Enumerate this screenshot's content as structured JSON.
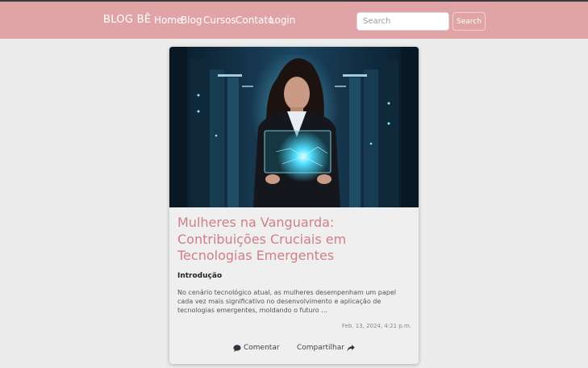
{
  "navbar": {
    "brand": "BLOG BÊ",
    "links": [
      "Home",
      "Blog",
      "Cursos",
      "Contato",
      "Login"
    ],
    "search_placeholder": "Search",
    "search_button": "Search"
  },
  "post": {
    "image_icon": "woman-holding-holographic-tablet-in-server-room",
    "title": "Mulheres na Vanguarda: Contribuições Cruciais em Tecnologias Emergentes",
    "section_heading": "Introdução",
    "excerpt": "No cenário tecnológico atual, as mulheres desempenham um papel cada vez mais significativo no desenvolvimento e aplicação de tecnologias emergentes, moldando o futuro ...",
    "date": "Feb. 13, 2024, 4:21 p.m.",
    "comment_label": "Comentar",
    "comment_icon": "comment-icon",
    "share_label": "Compartilhar",
    "share_icon": "share-icon"
  },
  "colors": {
    "navbar": "#e0a3a6",
    "title": "#cf7f86",
    "background": "#ececec",
    "card": "#efefef"
  }
}
